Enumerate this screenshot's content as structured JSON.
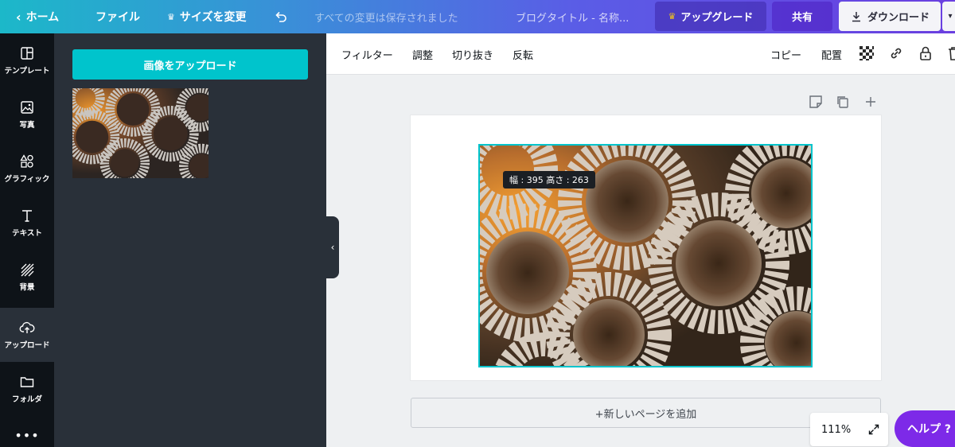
{
  "topbar": {
    "home_label": "ホーム",
    "file_label": "ファイル",
    "resize_label": "サイズを変更",
    "save_status": "すべての変更は保存されました",
    "design_title": "ブログタイトル - 名称...",
    "upgrade_label": "アップグレード",
    "share_label": "共有",
    "download_label": "ダウンロード"
  },
  "sidebar": {
    "items": [
      {
        "label": "テンプレート",
        "icon": "template-icon"
      },
      {
        "label": "写真",
        "icon": "photo-icon"
      },
      {
        "label": "グラフィック",
        "icon": "graphics-icon"
      },
      {
        "label": "テキスト",
        "icon": "text-icon"
      },
      {
        "label": "背景",
        "icon": "background-icon"
      },
      {
        "label": "アップロード",
        "icon": "upload-icon"
      },
      {
        "label": "フォルダ",
        "icon": "folder-icon"
      }
    ],
    "more": "•••"
  },
  "panel": {
    "upload_button": "画像をアップロード"
  },
  "image_toolbar": {
    "filter": "フィルター",
    "adjust": "調整",
    "crop": "切り抜き",
    "flip": "反転",
    "copy": "コピー",
    "arrange": "配置"
  },
  "canvas": {
    "size_tooltip": "幅 : 395 高さ : 263",
    "add_page": "+新しいページを追加"
  },
  "footer": {
    "zoom": "111%",
    "help": "ヘルプ ?"
  },
  "colors": {
    "accent": "#00c4cc",
    "purple": "#7d2ae8",
    "sidebar_dark": "#0e1318",
    "panel_dark": "#293039"
  }
}
